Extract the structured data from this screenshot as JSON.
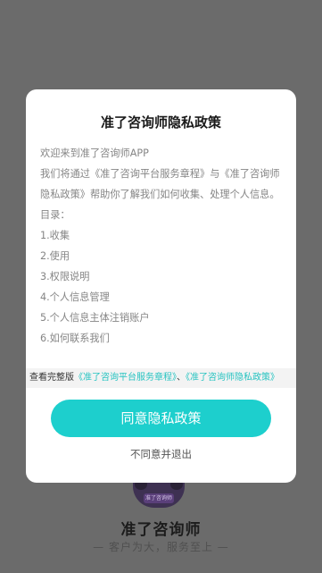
{
  "background_app": {
    "mascot_tag": "准了咨询师",
    "brand_name": "准了咨询师",
    "slogan": "— 客户为大，服务至上 —"
  },
  "dialog": {
    "title": "准了咨询师隐私政策",
    "intro": "欢迎来到准了咨询师APP",
    "paragraph": "我们将通过《准了咨询平台服务章程》与《准了咨询师隐私政策》帮助你了解我们如何收集、处理个人信息。",
    "toc_heading": "目录：",
    "toc_items": [
      "1.收集",
      "2.使用",
      "3.权限说明",
      "4.个人信息管理",
      "5.个人信息主体注销账户",
      "6.如何联系我们"
    ],
    "full_version": {
      "prefix": "查看完整版",
      "link1": "《准了咨询平台服务章程》",
      "separator": "、",
      "link2": "《准了咨询师隐私政策》"
    },
    "agree_label": "同意隐私政策",
    "disagree_label": "不同意并退出"
  }
}
